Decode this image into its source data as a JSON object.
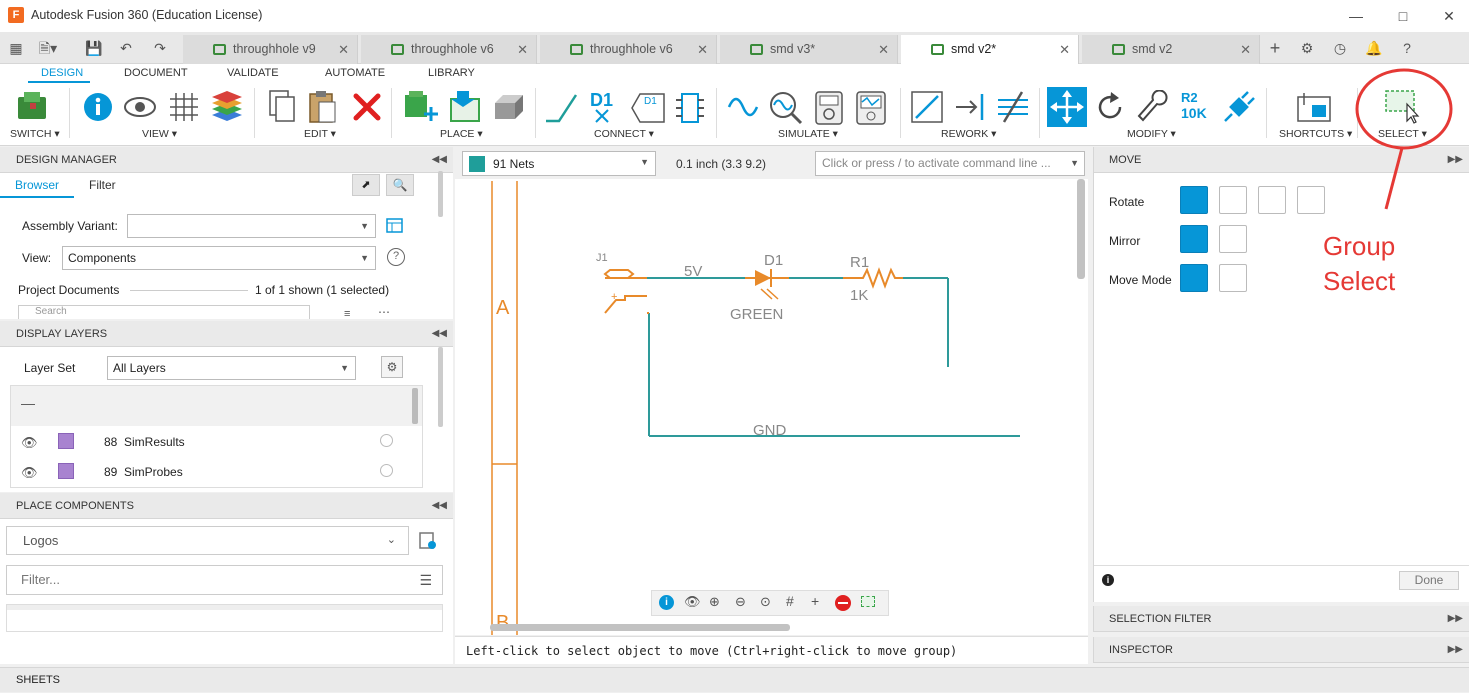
{
  "window": {
    "title": "Autodesk Fusion 360 (Education License)"
  },
  "tabs": [
    {
      "label": "throughhole v9",
      "active": false
    },
    {
      "label": "throughhole v6",
      "active": false
    },
    {
      "label": "throughhole v6",
      "active": false
    },
    {
      "label": "smd v3*",
      "active": false
    },
    {
      "label": "smd v2*",
      "active": true
    },
    {
      "label": "smd v2",
      "active": false
    }
  ],
  "ribbon": {
    "tabs": [
      "DESIGN",
      "DOCUMENT",
      "VALIDATE",
      "AUTOMATE",
      "LIBRARY"
    ],
    "groups": {
      "switch": "SWITCH ▾",
      "view": "VIEW ▾",
      "edit": "EDIT ▾",
      "place": "PLACE ▾",
      "connect": "CONNECT ▾",
      "simulate": "SIMULATE ▾",
      "rework": "REWORK ▾",
      "modify": "MODIFY ▾",
      "shortcuts": "SHORTCUTS ▾",
      "select": "SELECT ▾"
    },
    "connect_d1": "D1",
    "modify_r2": "R2",
    "modify_10k": "10K"
  },
  "design_manager": {
    "title": "DESIGN MANAGER",
    "tabs": [
      "Browser",
      "Filter"
    ],
    "assembly_variant_label": "Assembly Variant:",
    "assembly_variant_value": "",
    "view_label": "View:",
    "view_value": "Components",
    "project_documents": "Project Documents",
    "shown": "1 of 1 shown (1 selected)",
    "search_placeholder": "Search"
  },
  "display_layers": {
    "title": "DISPLAY LAYERS",
    "layer_set_label": "Layer Set",
    "layer_set_value": "All Layers",
    "dash": "—",
    "layers": [
      {
        "number": "88",
        "name": "SimResults",
        "color": "#a883d0"
      },
      {
        "number": "89",
        "name": "SimProbes",
        "color": "#a883d0"
      }
    ]
  },
  "place_components": {
    "title": "PLACE COMPONENTS",
    "library_value": "Logos",
    "filter_placeholder": "Filter..."
  },
  "toolbar": {
    "nets_value": "91 Nets",
    "grid_readout": "0.1 inch (3.3 9.2)",
    "command_placeholder": "Click or press / to activate command line ..."
  },
  "schematic": {
    "frame_row_a": "A",
    "frame_row_b": "B",
    "labels": {
      "j1": "J1",
      "net_5v": "5V",
      "d1": "D1",
      "green": "GREEN",
      "r1": "R1",
      "r_value": "1K",
      "gnd": "GND"
    },
    "wire_color": "#2e9a9a",
    "part_color": "#e88a2a"
  },
  "status_bar": "Left-click to select object to move (Ctrl+right-click to move group)",
  "move_panel": {
    "title": "MOVE",
    "rotate_label": "Rotate",
    "mirror_label": "Mirror",
    "move_mode_label": "Move Mode",
    "done_label": "Done"
  },
  "annotation": {
    "text_line1": "Group",
    "text_line2": "Select",
    "color": "#e53935"
  },
  "selection_filter": "SELECTION FILTER",
  "inspector": "INSPECTOR",
  "sheets": "SHEETS",
  "colors": {
    "accent": "#0696d7",
    "net_swatch": "#1f9e9a"
  }
}
